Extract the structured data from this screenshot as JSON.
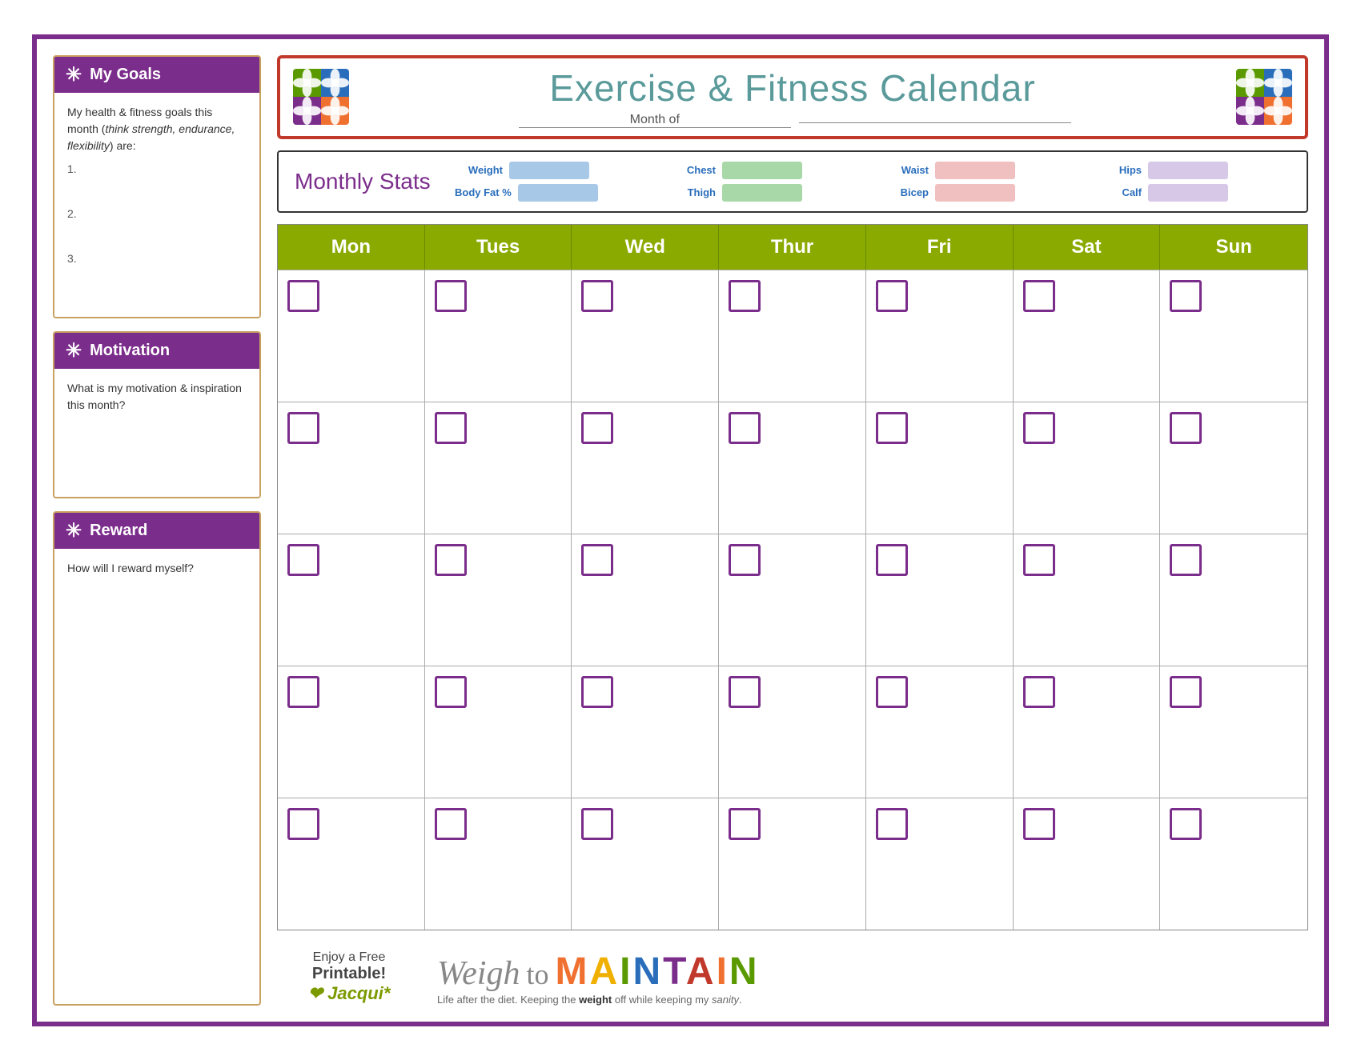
{
  "page": {
    "border_color": "#7b2d8b"
  },
  "sidebar": {
    "goals": {
      "header": "My Goals",
      "body_text": "My health & fitness goals this month (think strength, endurance, flexibility) are:",
      "goals": [
        "1.",
        "2.",
        "3."
      ]
    },
    "motivation": {
      "header": "Motivation",
      "body_text": "What is my motivation & inspiration this month?"
    },
    "reward": {
      "header": "Reward",
      "body_text": "How will I reward myself?"
    }
  },
  "header": {
    "title": "Exercise & Fitness Calendar",
    "month_label": "Month of"
  },
  "stats": {
    "title": "Monthly Stats",
    "items": [
      {
        "label": "Weight",
        "type": "blue-bar"
      },
      {
        "label": "Chest",
        "type": "green-bar"
      },
      {
        "label": "Waist",
        "type": "pink-bar"
      },
      {
        "label": "Hips",
        "type": "lavender-bar"
      },
      {
        "label": "Body Fat %",
        "type": "blue-bar"
      },
      {
        "label": "Thigh",
        "type": "green-bar"
      },
      {
        "label": "Bicep",
        "type": "pink-bar"
      },
      {
        "label": "Calf",
        "type": "lavender-bar"
      }
    ]
  },
  "calendar": {
    "days": [
      "Mon",
      "Tues",
      "Wed",
      "Thur",
      "Fri",
      "Sat",
      "Sun"
    ],
    "weeks": 5
  },
  "footer": {
    "enjoy": "Enjoy a Free",
    "printable": "Printable!",
    "jacqui": "Jacqui*",
    "brand_script": "Weigh to",
    "brand_main": "MAINTAIN",
    "brand_sub": "Life after the diet. Keeping the weight off while keeping my sanity."
  }
}
